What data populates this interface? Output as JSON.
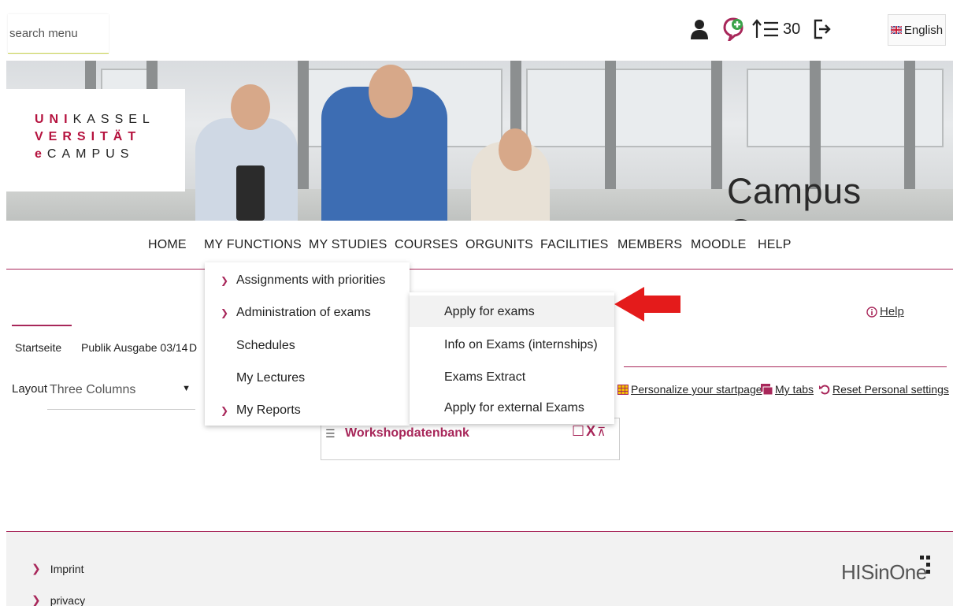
{
  "search": {
    "placeholder": "search menu"
  },
  "topbar": {
    "font_size_value": "30",
    "language_label": "English"
  },
  "banner": {
    "logo": {
      "line1_red": "UNI",
      "line1_rest": "KASSEL",
      "line2": "VERSITÄT",
      "line3_red": "e",
      "line3_rest": "CAMPUS"
    },
    "title": "Campus Center"
  },
  "nav": {
    "items": [
      "HOME",
      "MY FUNCTIONS",
      "MY STUDIES",
      "COURSES",
      "ORGUNITS",
      "FACILITIES",
      "MEMBERS",
      "MOODLE",
      "HELP"
    ]
  },
  "tabs": [
    "Startseite",
    "Publik Ausgabe 03/14",
    "D"
  ],
  "help_label": "Help",
  "layout": {
    "label": "Layout",
    "selected": "Three Columns"
  },
  "personalize": {
    "startpage": "Personalize your startpage",
    "my_tabs": "My tabs",
    "reset": "Reset Personal settings"
  },
  "portlet": {
    "title": "Workshopdatenbank"
  },
  "dropdown": {
    "items": [
      {
        "label": "Assignments with priorities",
        "expandable": true
      },
      {
        "label": "Administration of exams",
        "expandable": true
      },
      {
        "label": "Schedules",
        "expandable": false
      },
      {
        "label": "My Lectures",
        "expandable": false
      },
      {
        "label": "My Reports",
        "expandable": true
      }
    ],
    "submenu": [
      {
        "label": "Apply for exams",
        "active": true
      },
      {
        "label": "Info on Exams (internships)",
        "active": false
      },
      {
        "label": "Exams Extract",
        "active": false
      },
      {
        "label": "Apply for external Exams",
        "active": false
      }
    ]
  },
  "footer": {
    "links": [
      "Imprint",
      "privacy"
    ],
    "brand": "HISinOne"
  },
  "colors": {
    "accent": "#a8275a",
    "brand_red": "#b5123e",
    "arrow_red": "#e41b1b"
  }
}
